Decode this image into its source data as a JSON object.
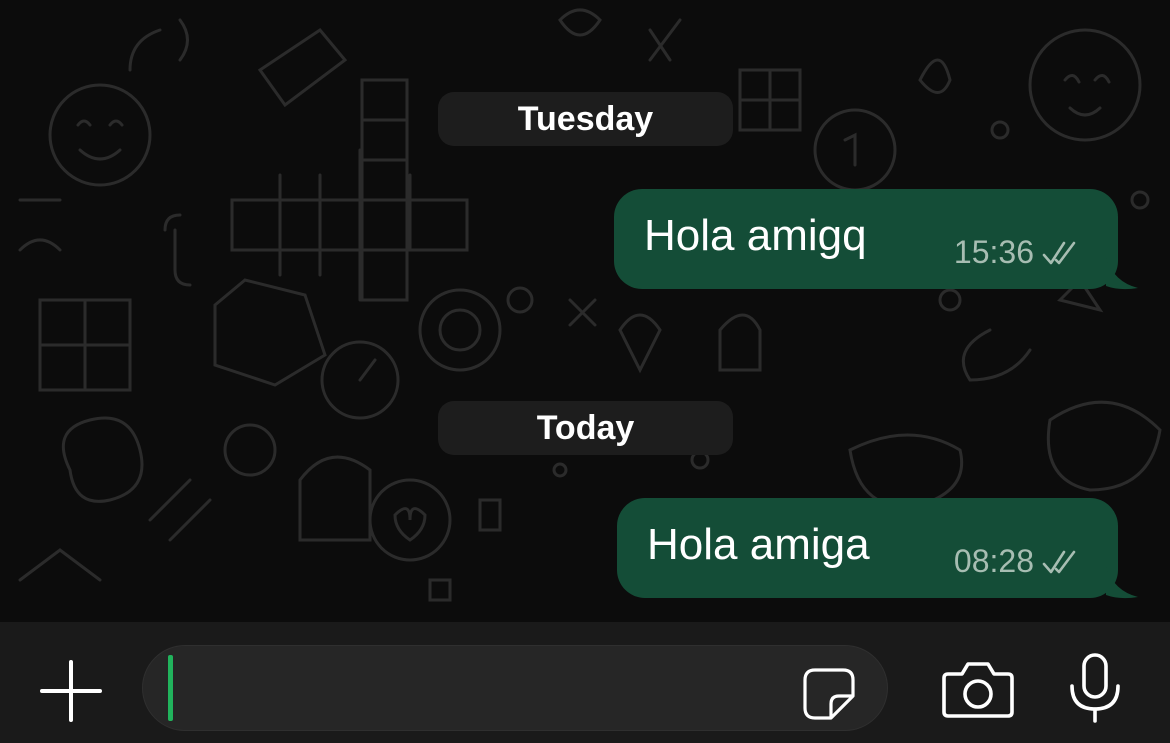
{
  "chat": {
    "days": [
      {
        "label": "Tuesday",
        "message": {
          "text": "Hola amigq",
          "time": "15:36",
          "status": "read-double-check"
        }
      },
      {
        "label": "Today",
        "message": {
          "text": "Hola amiga",
          "time": "08:28",
          "status": "read-double-check"
        }
      }
    ]
  },
  "composer": {
    "input_value": "",
    "icons": [
      "plus-icon",
      "sticker-icon",
      "camera-icon",
      "microphone-icon"
    ]
  },
  "colors": {
    "chat_background": "#0c0c0c",
    "outgoing_bubble": "#144d37",
    "date_pill": "#1d1d1d",
    "composer_background": "#1a1a1a",
    "cursor": "#21b35c"
  }
}
